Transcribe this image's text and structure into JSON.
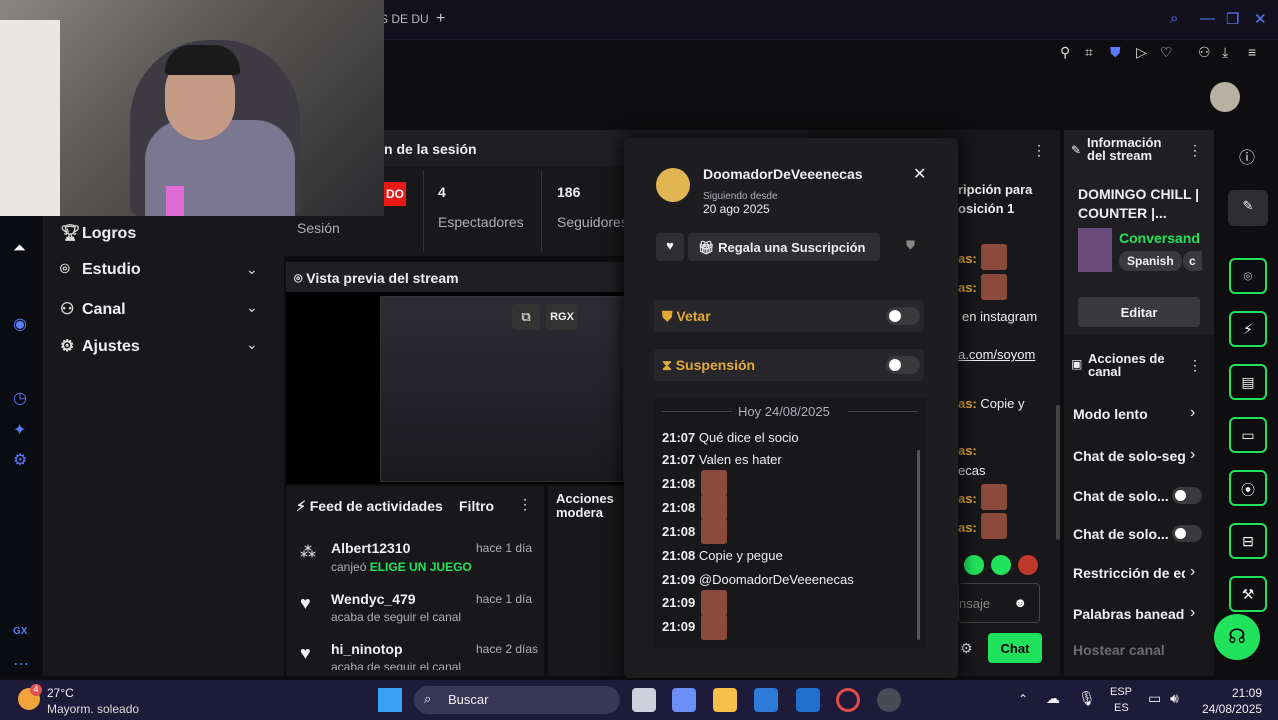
{
  "browser": {
    "tab": "S DE DU",
    "plus": "+"
  },
  "left_nav": {
    "items": [
      {
        "label": "Logros"
      },
      {
        "label": "Estudio"
      },
      {
        "label": "Canal"
      },
      {
        "label": "Ajustes"
      }
    ]
  },
  "session": {
    "title": "n de la sesión",
    "live_badge": "DO",
    "viewers_value": "4",
    "viewers_label": "Espectadores",
    "followers_value": "186",
    "followers_label": "Seguidores",
    "session_label": "Sesión"
  },
  "preview": {
    "title": "Vista previa del stream",
    "rgx": "RGX"
  },
  "feed": {
    "title": "Feed de actividades",
    "filter": "Filtro",
    "items": [
      {
        "user": "Albert12310",
        "time": "hace 1 día",
        "action": "canjeó",
        "highlight": "ELIGE UN JUEGO"
      },
      {
        "user": "Wendyc_479",
        "time": "hace 1 día",
        "action": "acaba de seguir el canal"
      },
      {
        "user": "hi_ninotop",
        "time": "hace 2 días",
        "action": "acaba de seguir el canal"
      }
    ]
  },
  "acciones_moderador": "Acciones modera",
  "popup": {
    "username": "DoomadorDeVeeenecas",
    "following_label": "Siguiendo desde",
    "following_date": "20 ago 2025",
    "gift_button": "Regala una Suscripción",
    "vetar": "Vetar",
    "suspension": "Suspensión",
    "date_divider": "Hoy 24/08/2025",
    "messages": [
      {
        "time": "21:07",
        "text": "Qué dice el socio"
      },
      {
        "time": "21:07",
        "text": "Valen es hater"
      },
      {
        "time": "21:08",
        "text": ""
      },
      {
        "time": "21:08",
        "text": ""
      },
      {
        "time": "21:08",
        "text": ""
      },
      {
        "time": "21:08",
        "text": "Copie y pegue"
      },
      {
        "time": "21:09",
        "text": "@DoomadorDeVeeenecas"
      },
      {
        "time": "21:09",
        "text": ""
      },
      {
        "time": "21:09",
        "text": ""
      }
    ]
  },
  "chat": {
    "line1": "ripción para",
    "line2": "osición 1",
    "line3": "en instagram",
    "line4": "a.com/soyom",
    "line5": "Copie y",
    "line6": "ecas",
    "placeholder": "nsaje",
    "send": "Chat",
    "as": "as:"
  },
  "stream_info": {
    "title": "Información del stream",
    "stream_title": "DOMINGO CHILL | COUNTER |...",
    "category": "Conversando",
    "tag1": "Spanish",
    "tag2": "c",
    "edit": "Editar"
  },
  "channel_actions": {
    "title": "Acciones de canal",
    "items": [
      {
        "label": "Modo lento"
      },
      {
        "label": "Chat de solo-seg"
      },
      {
        "label": "Chat de solo..."
      },
      {
        "label": "Chat de solo..."
      },
      {
        "label": "Restricción de ed"
      },
      {
        "label": "Palabras baneadı"
      },
      {
        "label": "Hostear canal"
      }
    ]
  },
  "taskbar": {
    "temp": "27°C",
    "weather": "Mayorm. soleado",
    "search": "Buscar",
    "lang1": "ESP",
    "lang2": "ES",
    "time": "21:09",
    "date": "24/08/2025",
    "badge": "4"
  },
  "colors": {
    "accent": "#21e35b",
    "live": "#e91916",
    "warning": "#e5a93a",
    "bg": "#18181b"
  }
}
